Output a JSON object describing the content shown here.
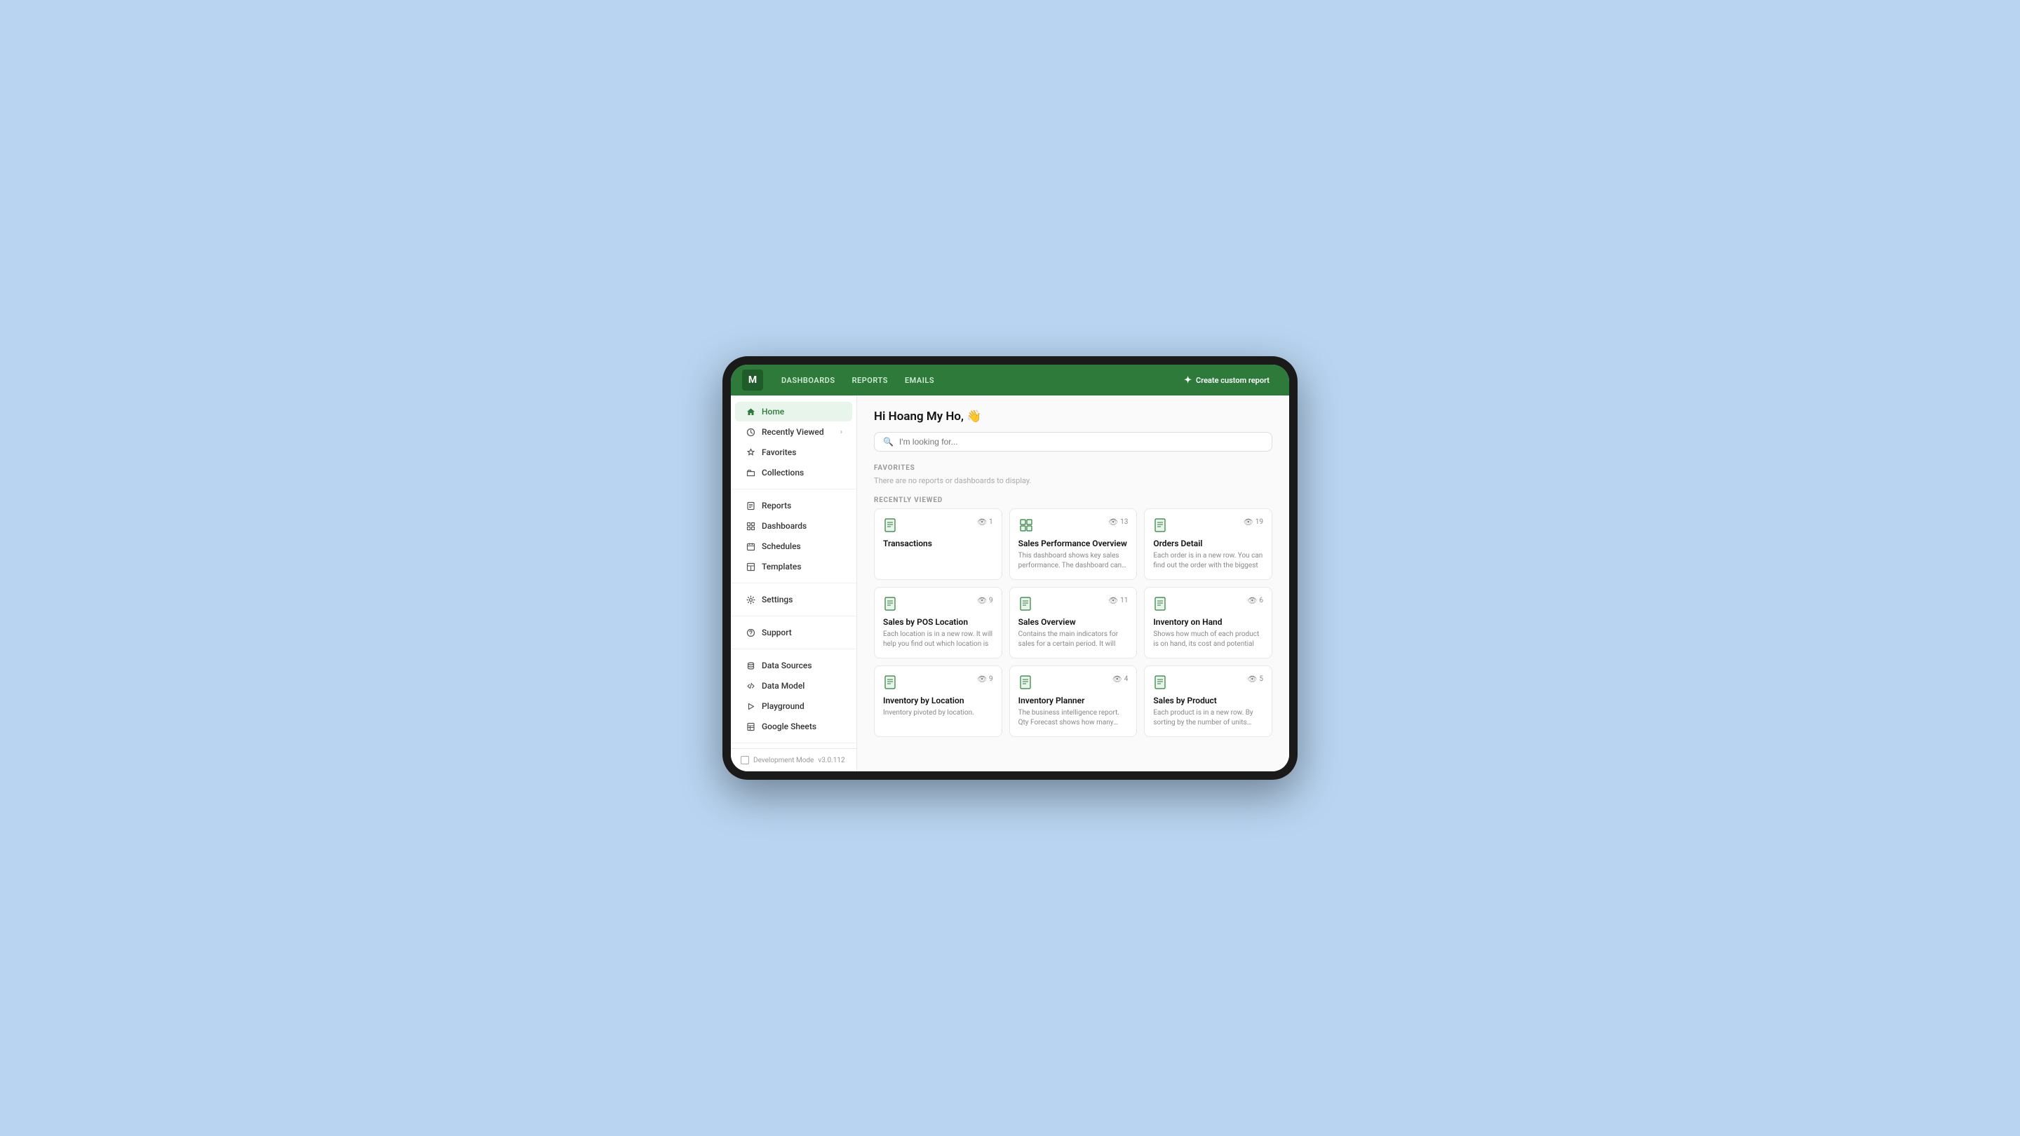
{
  "device": {
    "version": "v3.0.112"
  },
  "topnav": {
    "logo": "M",
    "links": [
      "DASHBOARDS",
      "REPORTS",
      "EMAILS"
    ],
    "create_label": "Create custom report"
  },
  "sidebar": {
    "sections": [
      {
        "items": [
          {
            "id": "home",
            "label": "Home",
            "icon": "home",
            "active": true
          },
          {
            "id": "recently-viewed",
            "label": "Recently Viewed",
            "icon": "clock",
            "has_chevron": true
          },
          {
            "id": "favorites",
            "label": "Favorites",
            "icon": "star"
          },
          {
            "id": "collections",
            "label": "Collections",
            "icon": "folder"
          }
        ]
      },
      {
        "items": [
          {
            "id": "reports",
            "label": "Reports",
            "icon": "report"
          },
          {
            "id": "dashboards",
            "label": "Dashboards",
            "icon": "dashboard"
          },
          {
            "id": "schedules",
            "label": "Schedules",
            "icon": "schedule"
          },
          {
            "id": "templates",
            "label": "Templates",
            "icon": "template"
          }
        ]
      },
      {
        "items": [
          {
            "id": "settings",
            "label": "Settings",
            "icon": "settings"
          }
        ]
      },
      {
        "items": [
          {
            "id": "support",
            "label": "Support",
            "icon": "support"
          }
        ]
      },
      {
        "items": [
          {
            "id": "data-sources",
            "label": "Data Sources",
            "icon": "database"
          },
          {
            "id": "data-model",
            "label": "Data Model",
            "icon": "code"
          },
          {
            "id": "playground",
            "label": "Playground",
            "icon": "play"
          },
          {
            "id": "google-sheets",
            "label": "Google Sheets",
            "icon": "sheets"
          }
        ]
      }
    ],
    "footer": {
      "dev_mode_label": "Development Mode",
      "version": "v3.0.112"
    }
  },
  "content": {
    "greeting": "Hi Hoang My Ho, 👋",
    "search_placeholder": "I'm looking for...",
    "favorites_label": "FAVORITES",
    "favorites_empty": "There are no reports or dashboards to display.",
    "recently_viewed_label": "RECENTLY VIEWED",
    "cards": [
      {
        "id": "transactions",
        "title": "Transactions",
        "desc": "",
        "views": 1,
        "type": "report"
      },
      {
        "id": "sales-performance-overview",
        "title": "Sales Performance Overview",
        "desc": "This dashboard shows key sales performance. The dashboard can be",
        "views": 13,
        "type": "dashboard"
      },
      {
        "id": "orders-detail",
        "title": "Orders Detail",
        "desc": "Each order is in a new row. You can find out the order with the biggest",
        "views": 19,
        "type": "report"
      },
      {
        "id": "sales-by-pos",
        "title": "Sales by POS Location",
        "desc": "Each location is in a new row. It will help you find out which location is",
        "views": 9,
        "type": "report"
      },
      {
        "id": "sales-overview",
        "title": "Sales Overview",
        "desc": "Contains the main indicators for sales for a certain period. It will",
        "views": 11,
        "type": "report"
      },
      {
        "id": "inventory-on-hand",
        "title": "Inventory on Hand",
        "desc": "Shows how much of each product is on hand, its cost and potential",
        "views": 6,
        "type": "report"
      },
      {
        "id": "inventory-by-location",
        "title": "Inventory by Location",
        "desc": "Inventory pivoted by location.",
        "views": 9,
        "type": "report"
      },
      {
        "id": "inventory-planner",
        "title": "Inventory Planner",
        "desc": "The business intelligence report. Qty Forecast shows how many units of",
        "views": 4,
        "type": "report"
      },
      {
        "id": "sales-by-product",
        "title": "Sales by Product",
        "desc": "Each product is in a new row. By sorting by the number of units sold,",
        "views": 5,
        "type": "report"
      }
    ]
  }
}
